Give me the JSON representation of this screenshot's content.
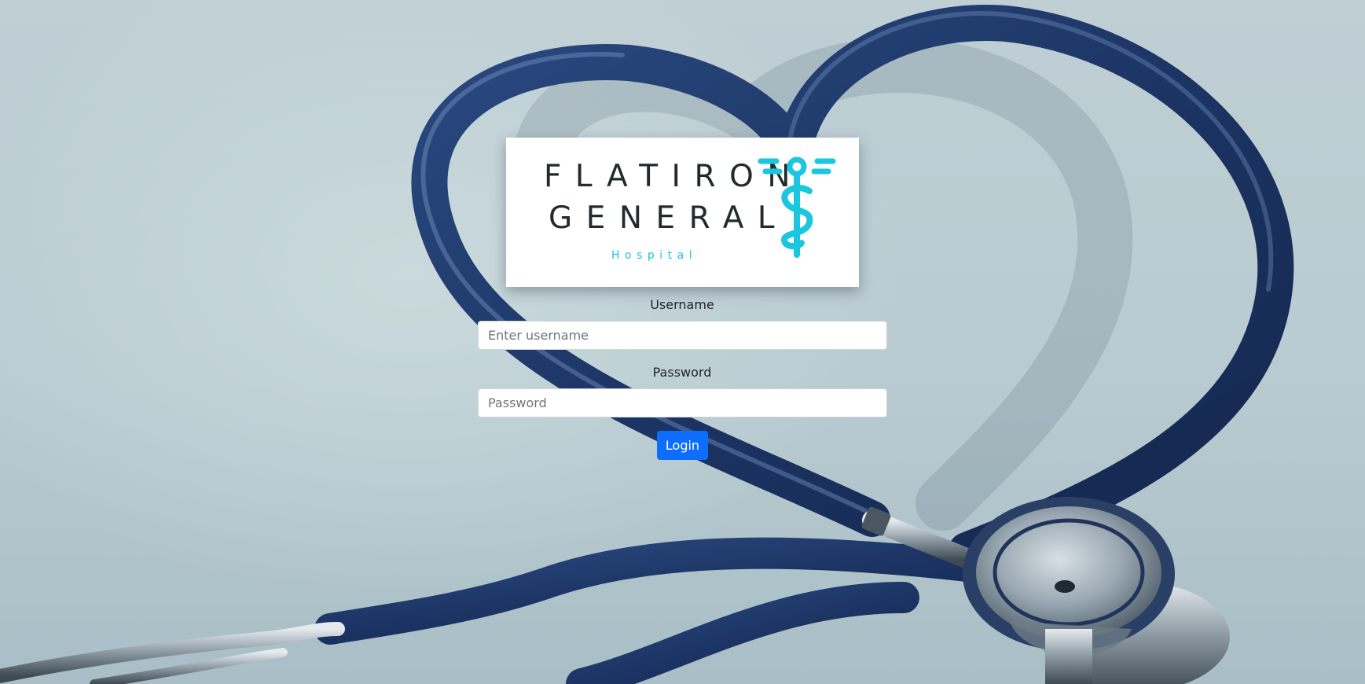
{
  "logo": {
    "line1": "FLATIRON",
    "line2": "GENERAL",
    "subtitle": "Hospital",
    "emblem_icon": "caduceus-icon",
    "brand_color": "#1ac7df",
    "text_color": "#222a2e"
  },
  "form": {
    "username_label": "Username",
    "username_placeholder": "Enter username",
    "username_value": "",
    "password_label": "Password",
    "password_placeholder": "Password",
    "password_value": "",
    "login_label": "Login",
    "button_color": "#0d6efd"
  },
  "background": {
    "image": "stethoscope-heart-photo",
    "tubing_color": "#1f3a6b"
  }
}
